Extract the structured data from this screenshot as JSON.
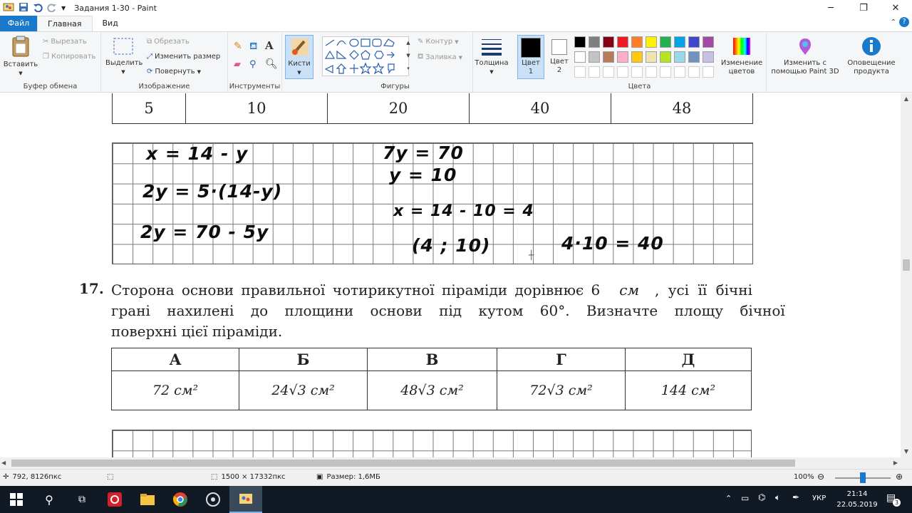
{
  "window": {
    "title": "Задания 1-30 - Paint",
    "minimize": "─",
    "restore": "❐",
    "close": "✕"
  },
  "tabs": [
    {
      "label": "Файл"
    },
    {
      "label": "Главная"
    },
    {
      "label": "Вид"
    }
  ],
  "ribbon": {
    "clipboard": {
      "paste": "Вставить",
      "cut": "Вырезать",
      "copy": "Копировать",
      "group": "Буфер обмена"
    },
    "image": {
      "select": "Выделить",
      "crop": "Обрезать",
      "resize": "Изменить размер",
      "rotate": "Повернуть",
      "group": "Изображение"
    },
    "tools": {
      "group": "Инструменты"
    },
    "brushes": {
      "label": "Кисти"
    },
    "shapes": {
      "outline": "Контур",
      "fill": "Заливка",
      "group": "Фигуры"
    },
    "thickness": {
      "label": "Толщина"
    },
    "colors": {
      "color1": "Цвет 1",
      "color2": "Цвет 2",
      "edit": "Изменение цветов",
      "group": "Цвета",
      "palette_row1": [
        "#000000",
        "#7f7f7f",
        "#880015",
        "#ed1c24",
        "#ff7f27",
        "#fff200",
        "#22b14c",
        "#00a2e8",
        "#3f48cc",
        "#a349a4"
      ],
      "palette_row2": [
        "#ffffff",
        "#c3c3c3",
        "#b97a57",
        "#ffaec9",
        "#ffc90e",
        "#efe4b0",
        "#b5e61d",
        "#99d9ea",
        "#7092be",
        "#c8bfe7"
      ]
    },
    "paint3d": "Изменить с помощью Paint 3D",
    "notify": "Оповещение продукта"
  },
  "doc": {
    "top_table": [
      "5",
      "10",
      "20",
      "40",
      "48"
    ],
    "handwriting": {
      "l1": "x = 14 - y",
      "l2": "2y = 5·(14-y)",
      "l3": "2y = 70 - 5y",
      "r1": "7y = 70",
      "r2": "y = 10",
      "r3": "x = 14 - 10 = 4",
      "r4": "(4 ; 10)",
      "r5": "4·10 = 40"
    },
    "task_number": "17.",
    "task_line1": "Сторона основи правильної чотирикутної піраміди дорівнює 6",
    "task_unit1": "см",
    "task_line1b": ", усі її бічні",
    "task_line2": "грані нахилені до площини основи під кутом 60°. Визначте площу бічної",
    "task_line3": "поверхні цієї піраміди.",
    "answer_headers": [
      "А",
      "Б",
      "В",
      "Г",
      "Д"
    ],
    "answers": [
      "72 см²",
      "24√3 см²",
      "48√3 см²",
      "72√3 см²",
      "144 см²"
    ]
  },
  "status": {
    "cursor": "792, 8126пкс",
    "dimensions": "1500 × 17332пкс",
    "size": "Размер: 1,6МБ",
    "zoom": "100%"
  },
  "taskbar": {
    "lang": "УКР",
    "time": "21:14",
    "date": "22.05.2019",
    "notif_count": "3"
  }
}
